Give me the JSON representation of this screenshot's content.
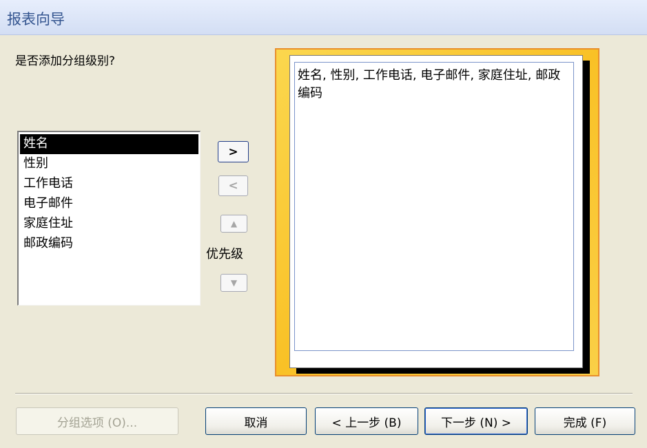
{
  "window": {
    "title": "报表向导"
  },
  "question": "是否添加分组级别?",
  "fields": {
    "items": [
      "姓名",
      "性别",
      "工作电话",
      "电子邮件",
      "家庭住址",
      "邮政编码"
    ],
    "selected_index": 0
  },
  "side_buttons": {
    "add_label": ">",
    "remove_label": "<",
    "up_label": "▲",
    "down_label": "▼",
    "priority_label": "优先级"
  },
  "preview": {
    "text": "姓名, 性别, 工作电话, 电子邮件, 家庭住址, 邮政编码"
  },
  "footer": {
    "grouping_options_label": "分组选项 (O)...",
    "cancel_label": "取消",
    "back_label": "< 上一步 (B)",
    "next_label": "下一步 (N) >",
    "finish_label": "完成 (F)"
  }
}
